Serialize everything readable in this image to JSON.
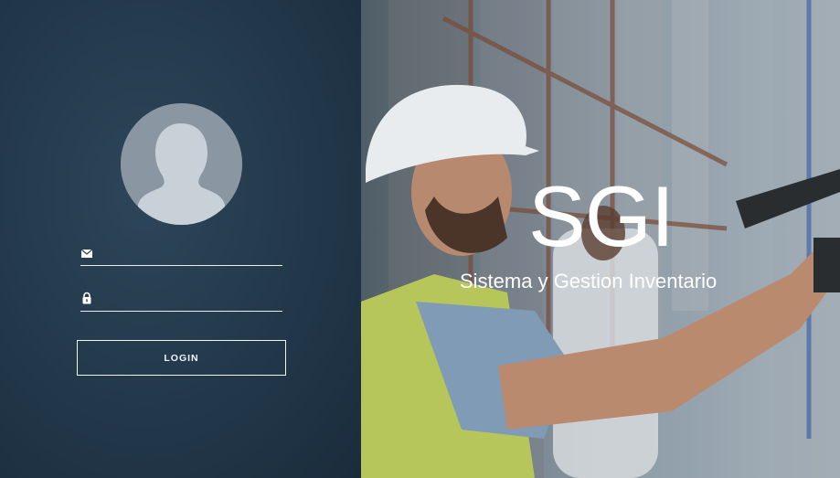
{
  "login": {
    "email_placeholder": "",
    "email_value": "",
    "password_placeholder": "",
    "password_value": "",
    "button_label": "LOGIN",
    "email_icon": "envelope-icon",
    "password_icon": "lock-icon"
  },
  "brand": {
    "title": "SGI",
    "subtitle": "Sistema y Gestion Inventario"
  },
  "colors": {
    "panel": "#243a4d",
    "avatar": "#8a96a1",
    "accent": "#ffffff"
  }
}
